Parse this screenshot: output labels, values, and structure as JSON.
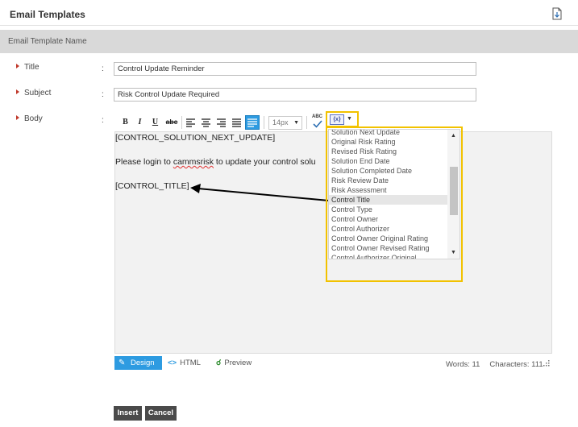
{
  "page": {
    "title": "Email Templates"
  },
  "section": {
    "title": "Email Template Name"
  },
  "form": {
    "title": {
      "label": "Title",
      "value": "Control Update Reminder"
    },
    "subject": {
      "label": "Subject",
      "value": "Risk Control Update Required"
    },
    "body": {
      "label": "Body"
    },
    "colon": ":"
  },
  "toolbar": {
    "bold": "B",
    "italic": "I",
    "underline": "U",
    "strikethrough": "abc",
    "font_size": "14px",
    "spellcheck": "ABC",
    "merge_fields_icon": "{x}"
  },
  "editor": {
    "lines": [
      "[CONTROL_SOLUTION_NEXT_UPDATE]",
      "Please login to ",
      "cammsrisk",
      " to update your control solu",
      "[CONTROL_TITLE]"
    ]
  },
  "merge_fields": {
    "items": [
      "Solution Next Update",
      "Original Risk Rating",
      "Revised Risk Rating",
      "Solution End Date",
      "Solution Completed Date",
      "Risk Review Date",
      "Risk Assessment",
      "Control Title",
      "Control Type",
      "Control Owner",
      "Control Authorizer",
      "Control Owner Original Rating",
      "Control Owner Revised Rating",
      "Control Authorizer Original"
    ],
    "selected": "Control Title"
  },
  "editor_modes": {
    "design": "Design",
    "html": "HTML",
    "preview": "Preview"
  },
  "stats": {
    "words": "Words: 11",
    "characters": "Characters: 111"
  },
  "actions": {
    "insert": "Insert",
    "cancel": "Cancel"
  },
  "colors": {
    "accent": "#2d9be1",
    "highlight": "#f2c200",
    "required": "#c0392b"
  }
}
